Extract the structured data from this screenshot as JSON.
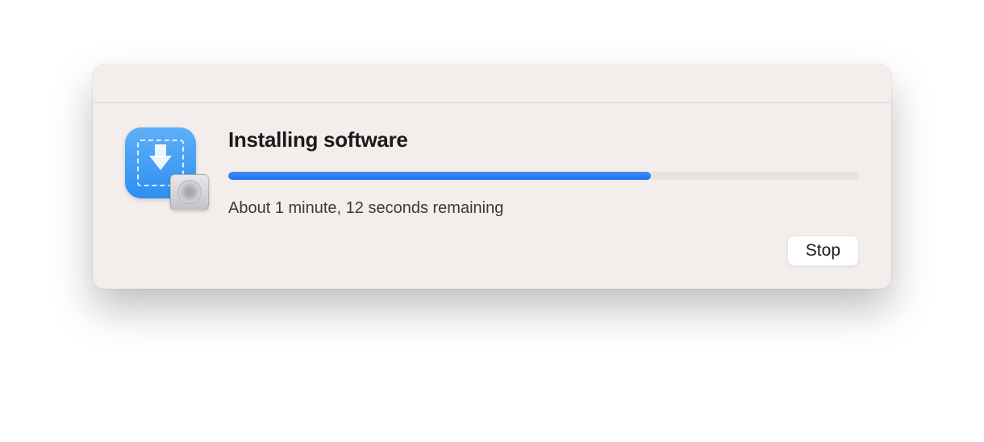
{
  "dialog": {
    "title": "Installing software",
    "status_text": "About 1 minute, 12 seconds remaining",
    "progress_percent": 67,
    "stop_label": "Stop"
  },
  "icons": {
    "app": "installer-download-icon",
    "disk": "hard-disk-icon"
  },
  "colors": {
    "accent": "#1e74f3",
    "dialog_bg": "#f3edec"
  }
}
